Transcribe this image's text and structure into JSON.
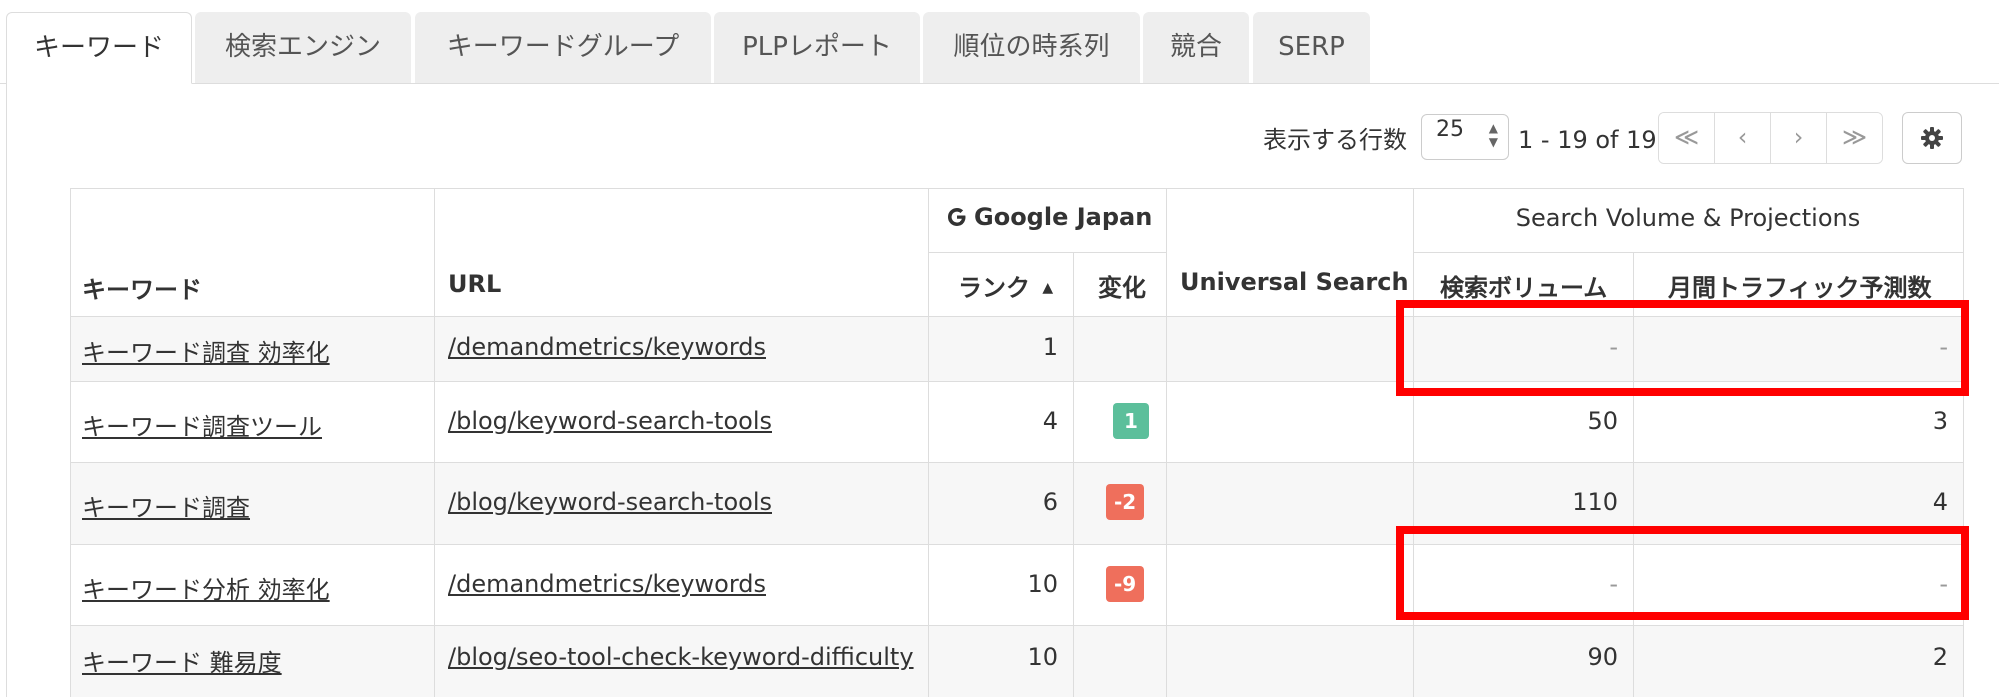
{
  "tabs": [
    {
      "label": "キーワード",
      "active": true
    },
    {
      "label": "検索エンジン",
      "active": false
    },
    {
      "label": "キーワードグループ",
      "active": false
    },
    {
      "label": "PLPレポート",
      "active": false
    },
    {
      "label": "順位の時系列",
      "active": false
    },
    {
      "label": "競合",
      "active": false
    },
    {
      "label": "SERP",
      "active": false
    }
  ],
  "toolbar": {
    "rows_label": "表示する行数",
    "rows_value": "25",
    "range": "1 - 19 of 19",
    "pager": {
      "first": "≪",
      "prev": "‹",
      "next": "›",
      "last": "≫"
    },
    "settings_icon": "gear-icon"
  },
  "table": {
    "engine_group": "Google Japan",
    "engine_icon": "google-g-icon",
    "volume_group": "Search Volume & Projections",
    "headers": {
      "keyword": "キーワード",
      "url": "URL",
      "rank": "ランク",
      "rank_sort_icon": "sort-up-icon",
      "change": "変化",
      "universal": "Universal Search",
      "volume": "検索ボリューム",
      "traffic": "月間トラフィック予測数"
    },
    "rows": [
      {
        "keyword": "キーワード調査 効率化",
        "url": "/demandmetrics/keywords",
        "rank": "1",
        "change": "",
        "change_dir": "",
        "universal": "",
        "volume": "-",
        "traffic": "-"
      },
      {
        "keyword": "キーワード調査ツール",
        "url": "/blog/keyword-search-tools",
        "rank": "4",
        "change": "1",
        "change_dir": "up",
        "universal": "",
        "volume": "50",
        "traffic": "3"
      },
      {
        "keyword": "キーワード調査",
        "url": "/blog/keyword-search-tools",
        "rank": "6",
        "change": "-2",
        "change_dir": "down",
        "universal": "",
        "volume": "110",
        "traffic": "4"
      },
      {
        "keyword": "キーワード分析 効率化",
        "url": "/demandmetrics/keywords",
        "rank": "10",
        "change": "-9",
        "change_dir": "down",
        "universal": "",
        "volume": "-",
        "traffic": "-"
      },
      {
        "keyword": "キーワード 難易度",
        "url": "/blog/seo-tool-check-keyword-difficulty",
        "rank": "10",
        "change": "",
        "change_dir": "",
        "universal": "",
        "volume": "90",
        "traffic": "2"
      }
    ]
  },
  "colors": {
    "highlight_box": "#ff0000",
    "badge_up": "#5cbf9b",
    "badge_down": "#ef6f5c"
  }
}
